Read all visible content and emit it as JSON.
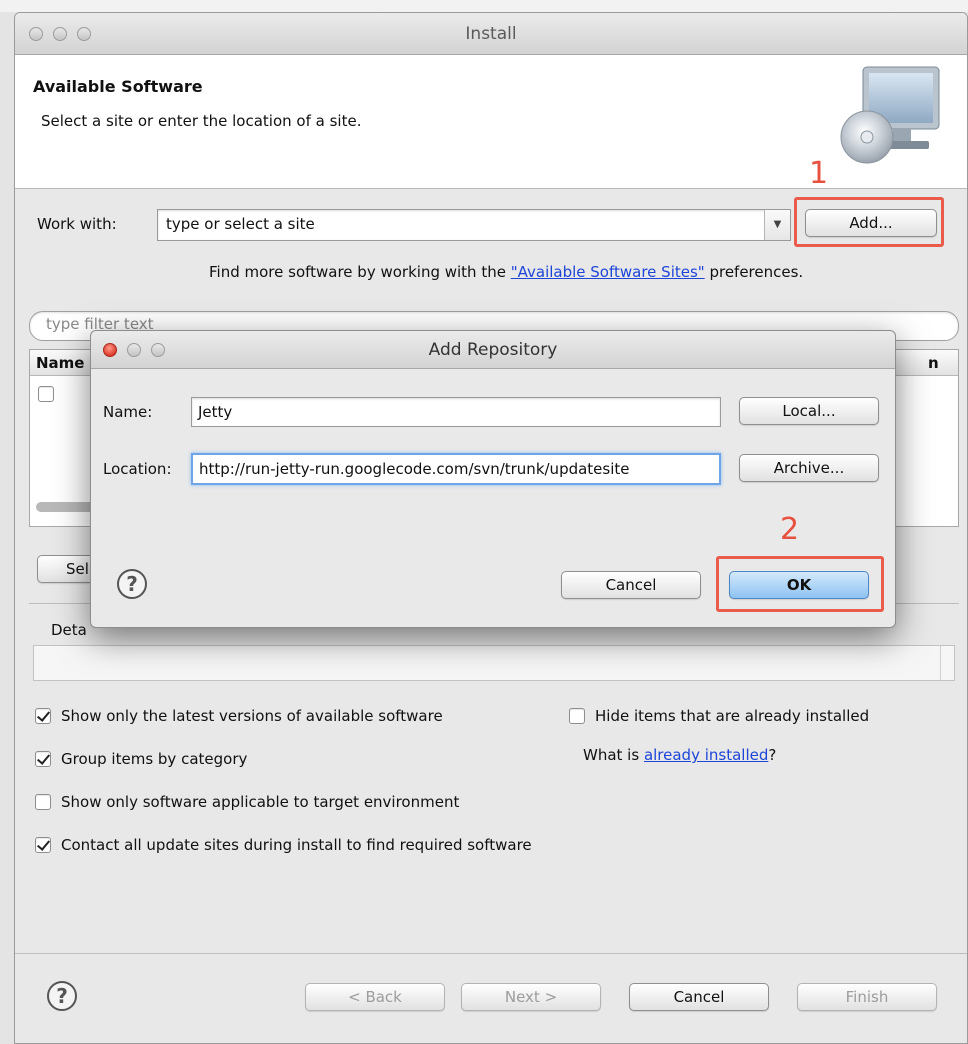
{
  "install_window": {
    "title": "Install",
    "header": {
      "title": "Available Software",
      "subtitle": "Select a site or enter the location of a site."
    },
    "work_with": {
      "label": "Work with:",
      "placeholder": "type or select a site",
      "add_button": "Add...",
      "step_label": "1"
    },
    "find_more": {
      "prefix": "Find more software by working with the ",
      "link": "\"Available Software Sites\"",
      "suffix": " preferences."
    },
    "filter_placeholder": "type filter text",
    "table": {
      "col_name": "Name",
      "col_version": "n"
    },
    "select_all_button_partial": "Sel",
    "details_label_partial": "Deta",
    "options": [
      {
        "label": "Show only the latest versions of available software",
        "checked": true
      },
      {
        "label": "Hide items that are already installed",
        "checked": false
      },
      {
        "label": "Group items by category",
        "checked": true
      },
      {
        "label": "Show only software applicable to target environment",
        "checked": false
      },
      {
        "label": "Contact all update sites during install to find required software",
        "checked": true
      }
    ],
    "what_is": {
      "prefix": "What is ",
      "link": "already installed",
      "suffix": "?"
    },
    "footer": {
      "back": "< Back",
      "next": "Next >",
      "cancel": "Cancel",
      "finish": "Finish"
    }
  },
  "add_repository_dialog": {
    "title": "Add Repository",
    "name_label": "Name:",
    "name_value": "Jetty",
    "location_label": "Location:",
    "location_value": "http://run-jetty-run.googlecode.com/svn/trunk/updatesite",
    "local_button": "Local...",
    "archive_button": "Archive...",
    "cancel_button": "Cancel",
    "ok_button": "OK",
    "step_label": "2"
  },
  "colors": {
    "annotation_red": "#ea5b4b",
    "link_blue": "#1d46d8",
    "default_button_blue": "#8ec3f1"
  }
}
